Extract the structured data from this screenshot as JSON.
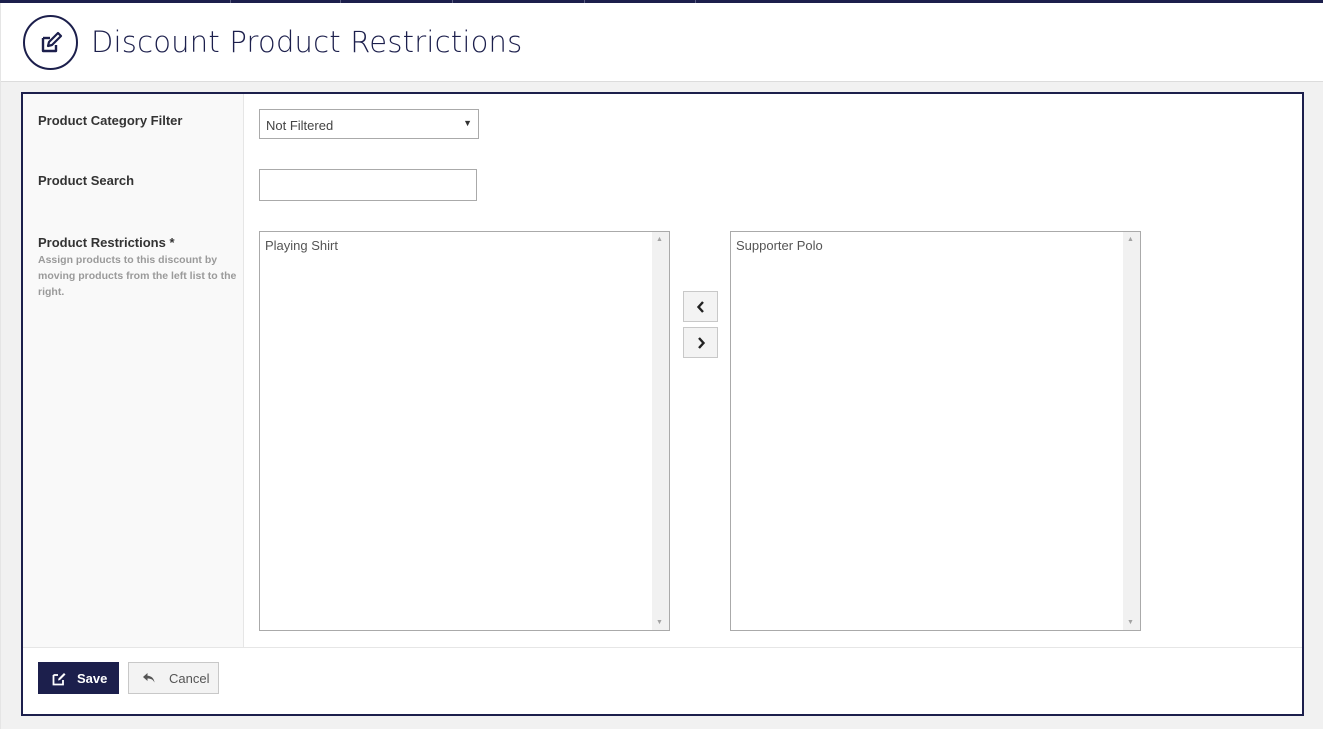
{
  "header": {
    "title": "Discount Product Restrictions",
    "icon": "edit-icon"
  },
  "form": {
    "category_filter": {
      "label": "Product Category Filter",
      "selected": "Not Filtered"
    },
    "product_search": {
      "label": "Product Search",
      "value": ""
    },
    "product_restrictions": {
      "label": "Product Restrictions *",
      "help": "Assign products to this discount by moving products from the left list to the right.",
      "available_items": [
        "Playing Shirt"
      ],
      "assigned_items": [
        "Supporter Polo"
      ]
    }
  },
  "buttons": {
    "move_left_icon": "chevron-left-icon",
    "move_right_icon": "chevron-right-icon",
    "save_label": "Save",
    "cancel_label": "Cancel"
  },
  "colors": {
    "brand": "#1c1f4c",
    "background": "#f1f1f1"
  }
}
